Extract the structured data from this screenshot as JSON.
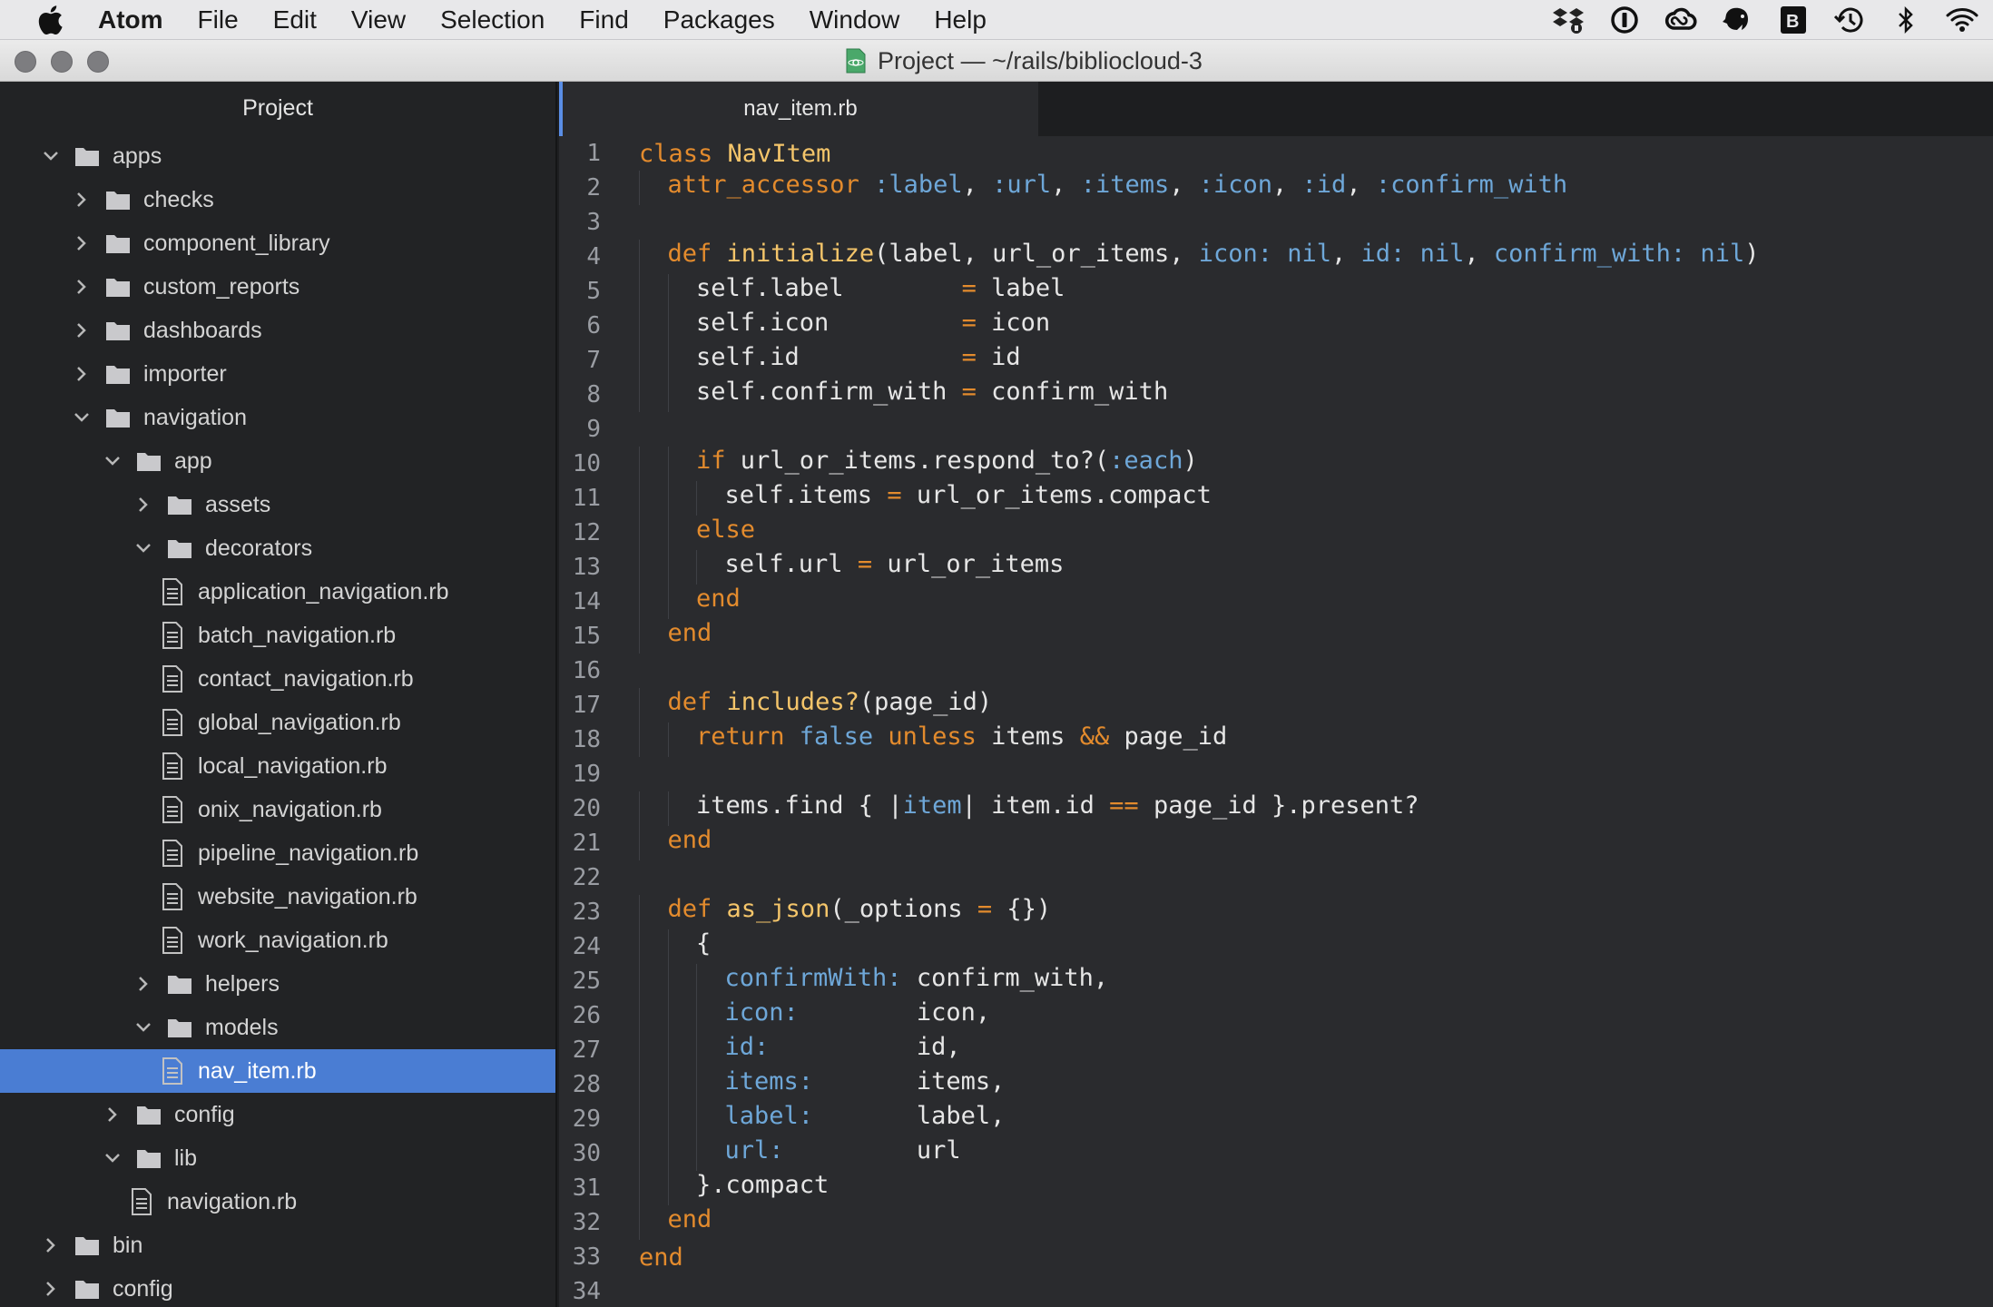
{
  "menubar": {
    "app_name": "Atom",
    "items": [
      "File",
      "Edit",
      "View",
      "Selection",
      "Find",
      "Packages",
      "Window",
      "Help"
    ],
    "tray_icons": [
      "dropbox-icon",
      "1password-icon",
      "creative-cloud-icon",
      "evernote-icon",
      "bbedit-icon",
      "time-machine-icon",
      "bluetooth-icon",
      "wifi-icon"
    ]
  },
  "window": {
    "title": "Project — ~/rails/bibliocloud-3"
  },
  "sidebar": {
    "header": "Project",
    "tree": [
      {
        "label": "apps",
        "type": "folder",
        "depth": 0,
        "expanded": true
      },
      {
        "label": "checks",
        "type": "folder",
        "depth": 1,
        "expanded": false
      },
      {
        "label": "component_library",
        "type": "folder",
        "depth": 1,
        "expanded": false
      },
      {
        "label": "custom_reports",
        "type": "folder",
        "depth": 1,
        "expanded": false
      },
      {
        "label": "dashboards",
        "type": "folder",
        "depth": 1,
        "expanded": false
      },
      {
        "label": "importer",
        "type": "folder",
        "depth": 1,
        "expanded": false
      },
      {
        "label": "navigation",
        "type": "folder",
        "depth": 1,
        "expanded": true
      },
      {
        "label": "app",
        "type": "folder",
        "depth": 2,
        "expanded": true
      },
      {
        "label": "assets",
        "type": "folder",
        "depth": 3,
        "expanded": false
      },
      {
        "label": "decorators",
        "type": "folder",
        "depth": 3,
        "expanded": true
      },
      {
        "label": "application_navigation.rb",
        "type": "file",
        "depth": 4
      },
      {
        "label": "batch_navigation.rb",
        "type": "file",
        "depth": 4
      },
      {
        "label": "contact_navigation.rb",
        "type": "file",
        "depth": 4
      },
      {
        "label": "global_navigation.rb",
        "type": "file",
        "depth": 4
      },
      {
        "label": "local_navigation.rb",
        "type": "file",
        "depth": 4
      },
      {
        "label": "onix_navigation.rb",
        "type": "file",
        "depth": 4
      },
      {
        "label": "pipeline_navigation.rb",
        "type": "file",
        "depth": 4
      },
      {
        "label": "website_navigation.rb",
        "type": "file",
        "depth": 4
      },
      {
        "label": "work_navigation.rb",
        "type": "file",
        "depth": 4
      },
      {
        "label": "helpers",
        "type": "folder",
        "depth": 3,
        "expanded": false
      },
      {
        "label": "models",
        "type": "folder",
        "depth": 3,
        "expanded": true
      },
      {
        "label": "nav_item.rb",
        "type": "file",
        "depth": 4,
        "selected": true
      },
      {
        "label": "config",
        "type": "folder",
        "depth": 2,
        "expanded": false
      },
      {
        "label": "lib",
        "type": "folder",
        "depth": 2,
        "expanded": true
      },
      {
        "label": "navigation.rb",
        "type": "file",
        "depth": 3
      },
      {
        "label": "bin",
        "type": "folder",
        "depth": 0,
        "expanded": false
      },
      {
        "label": "config",
        "type": "folder",
        "depth": 0,
        "expanded": false
      }
    ]
  },
  "editor": {
    "active_tab": "nav_item.rb",
    "lines": [
      {
        "n": "1",
        "indent": 0,
        "tokens": [
          [
            "k",
            "class "
          ],
          [
            "f",
            "NavItem"
          ]
        ]
      },
      {
        "n": "2",
        "indent": 1,
        "tokens": [
          [
            "k",
            "attr_accessor "
          ],
          [
            "s",
            ":label"
          ],
          [
            "p",
            ", "
          ],
          [
            "s",
            ":url"
          ],
          [
            "p",
            ", "
          ],
          [
            "s",
            ":items"
          ],
          [
            "p",
            ", "
          ],
          [
            "s",
            ":icon"
          ],
          [
            "p",
            ", "
          ],
          [
            "s",
            ":id"
          ],
          [
            "p",
            ", "
          ],
          [
            "s",
            ":confirm_with"
          ]
        ]
      },
      {
        "n": "3",
        "indent": 0,
        "tokens": []
      },
      {
        "n": "4",
        "indent": 1,
        "tokens": [
          [
            "k",
            "def "
          ],
          [
            "f",
            "initialize"
          ],
          [
            "p",
            "(label, url_or_items, "
          ],
          [
            "s",
            "icon: nil"
          ],
          [
            "p",
            ", "
          ],
          [
            "s",
            "id: nil"
          ],
          [
            "p",
            ", "
          ],
          [
            "s",
            "confirm_with: nil"
          ],
          [
            "p",
            ")"
          ]
        ]
      },
      {
        "n": "5",
        "indent": 2,
        "tokens": [
          [
            "p",
            "self.label        "
          ],
          [
            "k",
            "="
          ],
          [
            "p",
            " label"
          ]
        ]
      },
      {
        "n": "6",
        "indent": 2,
        "tokens": [
          [
            "p",
            "self.icon         "
          ],
          [
            "k",
            "="
          ],
          [
            "p",
            " icon"
          ]
        ]
      },
      {
        "n": "7",
        "indent": 2,
        "tokens": [
          [
            "p",
            "self.id           "
          ],
          [
            "k",
            "="
          ],
          [
            "p",
            " id"
          ]
        ]
      },
      {
        "n": "8",
        "indent": 2,
        "tokens": [
          [
            "p",
            "self.confirm_with "
          ],
          [
            "k",
            "="
          ],
          [
            "p",
            " confirm_with"
          ]
        ]
      },
      {
        "n": "9",
        "indent": 0,
        "tokens": []
      },
      {
        "n": "10",
        "indent": 2,
        "tokens": [
          [
            "k",
            "if "
          ],
          [
            "p",
            "url_or_items.respond_to?("
          ],
          [
            "s",
            ":each"
          ],
          [
            "p",
            ")"
          ]
        ]
      },
      {
        "n": "11",
        "indent": 3,
        "tokens": [
          [
            "p",
            "self.items "
          ],
          [
            "k",
            "="
          ],
          [
            "p",
            " url_or_items.compact"
          ]
        ]
      },
      {
        "n": "12",
        "indent": 2,
        "tokens": [
          [
            "k",
            "else"
          ]
        ]
      },
      {
        "n": "13",
        "indent": 3,
        "tokens": [
          [
            "p",
            "self.url "
          ],
          [
            "k",
            "="
          ],
          [
            "p",
            " url_or_items"
          ]
        ]
      },
      {
        "n": "14",
        "indent": 2,
        "tokens": [
          [
            "k",
            "end"
          ]
        ]
      },
      {
        "n": "15",
        "indent": 1,
        "tokens": [
          [
            "k",
            "end"
          ]
        ]
      },
      {
        "n": "16",
        "indent": 0,
        "tokens": []
      },
      {
        "n": "17",
        "indent": 1,
        "tokens": [
          [
            "k",
            "def "
          ],
          [
            "f",
            "includes?"
          ],
          [
            "p",
            "(page_id)"
          ]
        ]
      },
      {
        "n": "18",
        "indent": 2,
        "tokens": [
          [
            "k",
            "return "
          ],
          [
            "s",
            "false "
          ],
          [
            "k",
            "unless "
          ],
          [
            "p",
            "items "
          ],
          [
            "k",
            "&&"
          ],
          [
            "p",
            " page_id"
          ]
        ]
      },
      {
        "n": "19",
        "indent": 0,
        "tokens": []
      },
      {
        "n": "20",
        "indent": 2,
        "tokens": [
          [
            "p",
            "items.find { |"
          ],
          [
            "s",
            "item"
          ],
          [
            "p",
            "| item.id "
          ],
          [
            "k",
            "=="
          ],
          [
            "p",
            " page_id }.present?"
          ]
        ]
      },
      {
        "n": "21",
        "indent": 1,
        "tokens": [
          [
            "k",
            "end"
          ]
        ]
      },
      {
        "n": "22",
        "indent": 0,
        "tokens": []
      },
      {
        "n": "23",
        "indent": 1,
        "tokens": [
          [
            "k",
            "def "
          ],
          [
            "f",
            "as_json"
          ],
          [
            "p",
            "(_options "
          ],
          [
            "k",
            "="
          ],
          [
            "p",
            " {})"
          ]
        ]
      },
      {
        "n": "24",
        "indent": 2,
        "tokens": [
          [
            "p",
            "{"
          ]
        ]
      },
      {
        "n": "25",
        "indent": 3,
        "tokens": [
          [
            "s",
            "confirmWith: "
          ],
          [
            "p",
            "confirm_with,"
          ]
        ]
      },
      {
        "n": "26",
        "indent": 3,
        "tokens": [
          [
            "s",
            "icon:        "
          ],
          [
            "p",
            "icon,"
          ]
        ]
      },
      {
        "n": "27",
        "indent": 3,
        "tokens": [
          [
            "s",
            "id:          "
          ],
          [
            "p",
            "id,"
          ]
        ]
      },
      {
        "n": "28",
        "indent": 3,
        "tokens": [
          [
            "s",
            "items:       "
          ],
          [
            "p",
            "items,"
          ]
        ]
      },
      {
        "n": "29",
        "indent": 3,
        "tokens": [
          [
            "s",
            "label:       "
          ],
          [
            "p",
            "label,"
          ]
        ]
      },
      {
        "n": "30",
        "indent": 3,
        "tokens": [
          [
            "s",
            "url:         "
          ],
          [
            "p",
            "url"
          ]
        ]
      },
      {
        "n": "31",
        "indent": 2,
        "tokens": [
          [
            "p",
            "}.compact"
          ]
        ]
      },
      {
        "n": "32",
        "indent": 1,
        "tokens": [
          [
            "k",
            "end"
          ]
        ]
      },
      {
        "n": "33",
        "indent": 0,
        "tokens": [
          [
            "k",
            "end"
          ]
        ]
      },
      {
        "n": "34",
        "indent": 0,
        "tokens": []
      }
    ]
  }
}
